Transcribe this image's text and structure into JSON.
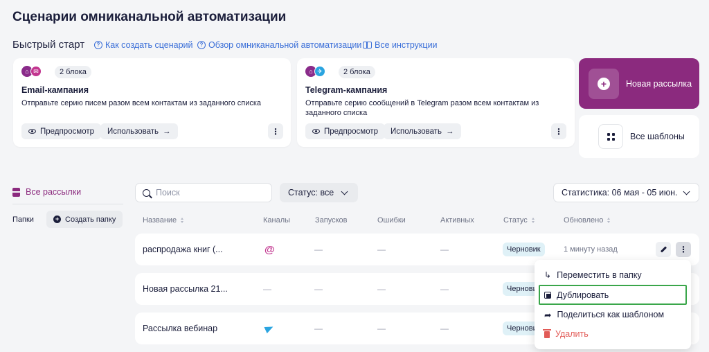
{
  "page": {
    "title": "Сценарии омниканальной автоматизации"
  },
  "quick_start": {
    "label": "Быстрый старт",
    "links": [
      {
        "label": "Как создать сценарий",
        "icon": "question-circle-icon"
      },
      {
        "label": "Обзор омниканальной автоматизации",
        "icon": "question-circle-icon"
      },
      {
        "label": "Все инструкции",
        "icon": "book-icon"
      }
    ]
  },
  "templates": [
    {
      "channels": [
        "email"
      ],
      "blocks": "2 блока",
      "title": "Email-кампания",
      "desc": "Отправьте серию писем разом всем контактам из заданного списка",
      "preview": "Предпросмотр",
      "use": "Использовать"
    },
    {
      "channels": [
        "telegram"
      ],
      "blocks": "2 блока",
      "title": "Telegram-кампания",
      "desc": "Отправьте серию сообщений в Telegram разом всем контактам из заданного списка",
      "preview": "Предпросмотр",
      "use": "Использовать"
    }
  ],
  "actions": {
    "new_mailing": "Новая рассылка",
    "all_templates": "Все шаблоны"
  },
  "sidebar": {
    "all_mailings": "Все рассылки",
    "folders": "Папки",
    "create_folder": "Создать папку"
  },
  "filters": {
    "search_placeholder": "Поиск",
    "status": "Статус: все",
    "stats": "Статистика: 06 мая - 05 июн."
  },
  "table": {
    "columns": [
      "Название",
      "Каналы",
      "Запусков",
      "Ошибки",
      "Активных",
      "Статус",
      "Обновлено"
    ],
    "rows": [
      {
        "name": "распродажа книг (...",
        "channel": "email",
        "launches": "—",
        "errors": "—",
        "active": "—",
        "status": "Черновик",
        "updated": "1 минуту назад"
      },
      {
        "name": "Новая рассылка 21...",
        "channel": "—",
        "launches": "—",
        "errors": "—",
        "active": "—",
        "status": "Черновик",
        "updated": ""
      },
      {
        "name": "Рассылка вебинар",
        "channel": "telegram",
        "launches": "—",
        "errors": "—",
        "active": "—",
        "status": "Черновик",
        "updated": ""
      }
    ]
  },
  "context_menu": {
    "items": [
      {
        "label": "Переместить в папку",
        "icon": "move-arrow-icon"
      },
      {
        "label": "Дублировать",
        "icon": "copy-icon",
        "highlighted": true
      },
      {
        "label": "Поделиться как шаблоном",
        "icon": "share-icon"
      },
      {
        "label": "Удалить",
        "icon": "trash-icon",
        "danger": true
      }
    ]
  },
  "colors": {
    "brand": "#8b2a7e",
    "link": "#3b6fd8",
    "danger": "#e25b57",
    "highlight": "#3aa64a",
    "status_badge": "#dff1f7"
  }
}
